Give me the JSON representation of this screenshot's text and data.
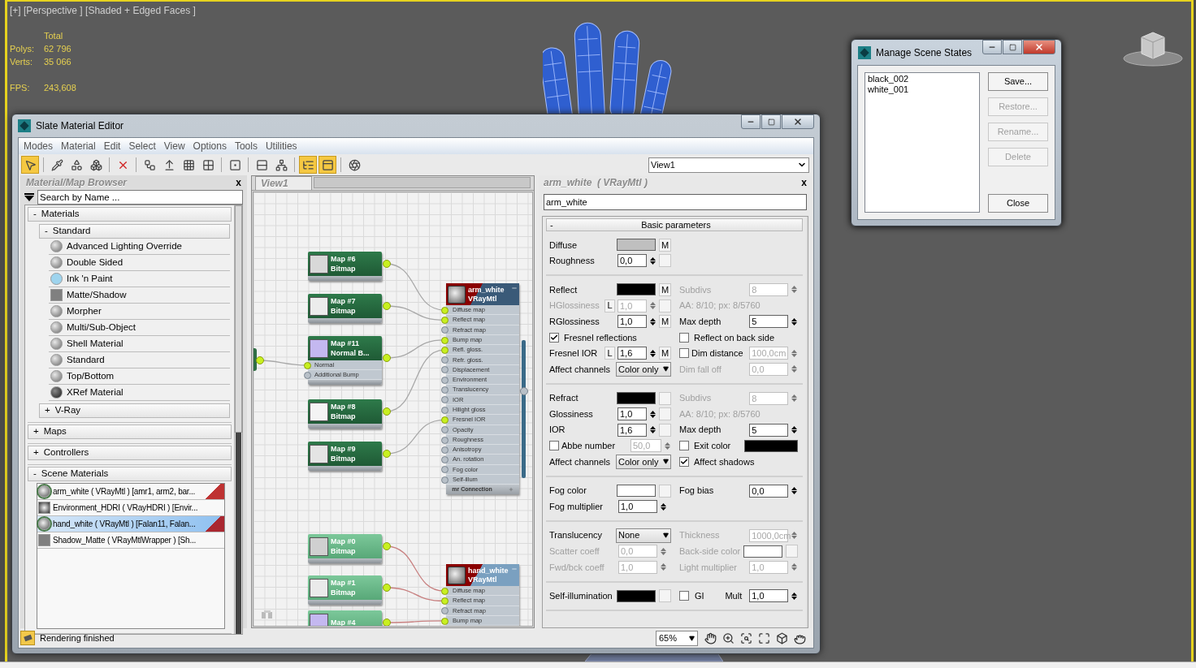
{
  "viewport": {
    "label": "[+] [Perspective ] [Shaded + Edged Faces ]",
    "stats_header": "Total",
    "stats": [
      {
        "label": "Polys:",
        "value": "62 796"
      },
      {
        "label": "Verts:",
        "value": "35 066"
      }
    ],
    "fps": {
      "label": "FPS:",
      "value": "243,608"
    }
  },
  "scene_states": {
    "title": "Manage Scene States",
    "items": [
      {
        "label": "black_002",
        "selected": false
      },
      {
        "label": "white_001",
        "selected": false
      }
    ],
    "buttons": [
      {
        "label": "Save...",
        "disabled": false
      },
      {
        "label": "Restore...",
        "disabled": true
      },
      {
        "label": "Rename...",
        "disabled": true
      },
      {
        "label": "Delete",
        "disabled": true
      }
    ],
    "close": "Close"
  },
  "slate_editor": {
    "title": "Slate Material Editor",
    "menu": [
      "Modes",
      "Material",
      "Edit",
      "Select",
      "View",
      "Options",
      "Tools",
      "Utilities"
    ],
    "toolbar": [
      {
        "on": true
      },
      {
        "on": false
      },
      {
        "on": false
      },
      {
        "on": false
      },
      {
        "on": false
      },
      {
        "on": false
      },
      {
        "on": false
      },
      {
        "on": false
      },
      {
        "on": false
      },
      {
        "on": false
      },
      {
        "on": false
      },
      {
        "on": false
      },
      {
        "on": true
      },
      {
        "on": true
      },
      {
        "on": false
      }
    ],
    "view_select": "View1",
    "browser": {
      "title": "Material/Map Browser",
      "close": "x",
      "search_placeholder": "Search by Name ...",
      "groups": [
        {
          "toggle": "-",
          "label": "Materials",
          "subgroups": [
            {
              "toggle": "-",
              "label": "Standard",
              "items": [
                {
                  "label": "Advanced Lighting Override",
                  "kind": "sphere"
                },
                {
                  "label": "Double Sided",
                  "kind": "sphere"
                },
                {
                  "label": "Ink 'n Paint",
                  "kind": "ink"
                },
                {
                  "label": "Matte/Shadow",
                  "kind": "matte"
                },
                {
                  "label": "Morpher",
                  "kind": "sphere"
                },
                {
                  "label": "Multi/Sub-Object",
                  "kind": "sphere"
                },
                {
                  "label": "Shell Material",
                  "kind": "sphere"
                },
                {
                  "label": "Standard",
                  "kind": "sphere"
                },
                {
                  "label": "Top/Bottom",
                  "kind": "sphere"
                },
                {
                  "label": "XRef Material",
                  "kind": "xref"
                }
              ]
            },
            {
              "toggle": "+",
              "label": "V-Ray"
            }
          ]
        },
        {
          "toggle": "+",
          "label": "Maps"
        },
        {
          "toggle": "+",
          "label": "Controllers"
        },
        {
          "toggle": "-",
          "label": "Scene Materials",
          "scene_items": [
            {
              "label": "arm_white  ( VRayMtl )  [amr1, arm2, bar...",
              "kind": "vray",
              "flag": true,
              "selected": false
            },
            {
              "label": "Environment_HDRI  ( VRayHDRI )  [Envir...",
              "kind": "hdri",
              "flag": false,
              "selected": false
            },
            {
              "label": "hand_white  ( VRayMtl )  [Falan11, Falan...",
              "kind": "vray",
              "flag": true,
              "selected": true
            },
            {
              "label": "Shadow_Matte  ( VRayMtlWrapper )  [Sh...",
              "kind": "matte",
              "flag": false,
              "selected": false
            }
          ]
        }
      ]
    },
    "view": {
      "tab": "View1",
      "maps": [
        {
          "title": "Map #6",
          "subtitle": "Bitmap",
          "active": true,
          "color": "#d8d8d8"
        },
        {
          "title": "Map #7",
          "subtitle": "Bitmap",
          "active": true,
          "color": "#ececec"
        },
        {
          "title": "Map #11",
          "subtitle": "Normal B...",
          "active": true,
          "color": "#c4b8f0",
          "slots": [
            {
              "label": "Normal",
              "connected": true
            },
            {
              "label": "Additional Bump",
              "connected": false
            }
          ]
        },
        {
          "title": "Map #8",
          "subtitle": "Bitmap",
          "active": true,
          "color": "#f4f4f4"
        },
        {
          "title": "Map #9",
          "subtitle": "Bitmap",
          "active": true,
          "color": "#e4e4e4"
        },
        {
          "title": "Map #0",
          "subtitle": "Bitmap",
          "active": false,
          "color": "#d0d0d0"
        },
        {
          "title": "Map #1",
          "subtitle": "Bitmap",
          "active": false,
          "color": "#eaeaea"
        },
        {
          "title": "Map #4",
          "active": false,
          "color": "#c4b8f0"
        }
      ],
      "materials": [
        {
          "title": "arm_white",
          "subtitle": "VRayMtl",
          "active": true,
          "footer": "mr Connection",
          "slots": [
            {
              "label": "Diffuse map",
              "connected": true
            },
            {
              "label": "Reflect map",
              "connected": true
            },
            {
              "label": "Refract map",
              "connected": false
            },
            {
              "label": "Bump map",
              "connected": true
            },
            {
              "label": "Refl. gloss.",
              "connected": true
            },
            {
              "label": "Refr. gloss.",
              "connected": false
            },
            {
              "label": "Displacement",
              "connected": false
            },
            {
              "label": "Environment",
              "connected": false
            },
            {
              "label": "Translucency",
              "connected": false
            },
            {
              "label": "IOR",
              "connected": false
            },
            {
              "label": "Hilight gloss",
              "connected": false
            },
            {
              "label": "Fresnel IOR",
              "connected": true
            },
            {
              "label": "Opacity",
              "connected": false
            },
            {
              "label": "Roughness",
              "connected": false
            },
            {
              "label": "Anisotropy",
              "connected": false
            },
            {
              "label": "An. rotation",
              "connected": false
            },
            {
              "label": "Fog color",
              "connected": false
            },
            {
              "label": "Self-illum",
              "connected": false
            }
          ]
        },
        {
          "title": "hand_white",
          "subtitle": "VRayMtl",
          "active": false,
          "slots": [
            {
              "label": "Diffuse map",
              "connected": true
            },
            {
              "label": "Reflect map",
              "connected": true
            },
            {
              "label": "Refract map",
              "connected": false
            },
            {
              "label": "Bump map",
              "connected": true
            }
          ]
        }
      ]
    },
    "params": {
      "title": "arm_white  ( VRayMtl )",
      "close": "x",
      "name": "arm_white",
      "rollout": {
        "toggle": "-",
        "title": "Basic parameters"
      },
      "sections": [
        [
          {
            "left": {
              "kind": "color",
              "label": "Diffuse",
              "color": "#bfbfbf",
              "map": "M"
            }
          },
          {
            "left": {
              "kind": "spinner",
              "label": "Roughness",
              "value": "0,0",
              "has_map": true,
              "disabled": false
            }
          }
        ],
        [
          {
            "left": {
              "kind": "color",
              "label": "Reflect",
              "color": "#000000",
              "map": "M"
            },
            "right": {
              "kind": "spinner",
              "label": "Subdivs",
              "value": "8",
              "disabled": true
            }
          },
          {
            "left": {
              "kind": "spinner",
              "label": "HGlossiness",
              "lock": "L",
              "value": "1,0",
              "has_map": true,
              "disabled": true
            },
            "right": {
              "kind": "note",
              "label": "AA: 8/10; px: 8/5760",
              "disabled": true
            }
          },
          {
            "left": {
              "kind": "spinner",
              "label": "RGlossiness",
              "value": "1,0",
              "map": "M",
              "disabled": false
            },
            "right": {
              "kind": "spinner",
              "label": "Max depth",
              "value": "5",
              "disabled": false
            }
          },
          {
            "left": {
              "kind": "check",
              "label": "Fresnel reflections",
              "checked": true
            },
            "right": {
              "kind": "check",
              "label": "Reflect on back side",
              "checked": false
            }
          },
          {
            "left": {
              "kind": "spinner",
              "label": "Fresnel IOR",
              "lock": "L",
              "value": "1,6",
              "map": "M",
              "disabled": false
            },
            "right": {
              "kind": "spinner",
              "label": "Dim distance",
              "check": false,
              "value": "100,0cm",
              "disabled": true
            }
          },
          {
            "left": {
              "kind": "dropdown",
              "label": "Affect channels",
              "value": "Color only"
            },
            "right": {
              "kind": "spinner",
              "label": "Dim fall off",
              "value": "0,0",
              "disabled": true
            }
          }
        ],
        [
          {
            "left": {
              "kind": "color",
              "label": "Refract",
              "color": "#000000"
            },
            "right": {
              "kind": "spinner",
              "label": "Subdivs",
              "value": "8",
              "disabled": true
            }
          },
          {
            "left": {
              "kind": "spinner",
              "label": "Glossiness",
              "value": "1,0",
              "has_map": true,
              "disabled": false
            },
            "right": {
              "kind": "note",
              "label": "AA: 8/10; px: 8/5760",
              "disabled": true
            }
          },
          {
            "left": {
              "kind": "spinner",
              "label": "IOR",
              "value": "1,6",
              "has_map": true,
              "disabled": false
            },
            "right": {
              "kind": "spinner",
              "label": "Max depth",
              "value": "5",
              "disabled": false
            }
          },
          {
            "left": {
              "kind": "spinner",
              "label": "Abbe number",
              "check": false,
              "value": "50,0",
              "disabled": true
            },
            "right": {
              "kind": "checkcolor",
              "label": "Exit color",
              "checked": false,
              "color": "#000000"
            }
          },
          {
            "left": {
              "kind": "dropdown",
              "label": "Affect channels",
              "value": "Color only"
            },
            "right": {
              "kind": "check",
              "label": "Affect shadows",
              "checked": true
            }
          }
        ],
        [
          {
            "left": {
              "kind": "color",
              "label": "Fog color",
              "color": "#ffffff"
            },
            "right": {
              "kind": "spinner",
              "label": "Fog bias",
              "value": "0,0",
              "disabled": false
            }
          },
          {
            "left": {
              "kind": "spinner",
              "label": "Fog multiplier",
              "value": "1,0",
              "disabled": false
            }
          }
        ],
        [
          {
            "left": {
              "kind": "dropdown",
              "label": "Translucency",
              "value": "None"
            },
            "right": {
              "kind": "spinner",
              "label": "Thickness",
              "value": "1000,0cm",
              "disabled": true
            }
          },
          {
            "left": {
              "kind": "spinner",
              "label": "Scatter coeff",
              "value": "0,0",
              "disabled": true
            },
            "right": {
              "kind": "color",
              "label": "Back-side color",
              "color": "#ffffff",
              "disabled": true
            }
          },
          {
            "left": {
              "kind": "spinner",
              "label": "Fwd/bck coeff",
              "value": "1,0",
              "disabled": true
            },
            "right": {
              "kind": "spinner",
              "label": "Light multiplier",
              "value": "1,0",
              "disabled": true
            }
          }
        ],
        [
          {
            "left": {
              "kind": "color",
              "label": "Self-illumination",
              "color": "#000000"
            },
            "right": {
              "kind": "gimult",
              "label": "GI",
              "checked": false,
              "mult_label": "Mult",
              "value": "1,0"
            }
          }
        ]
      ]
    },
    "zoom": "65%",
    "status": "Rendering finished"
  }
}
